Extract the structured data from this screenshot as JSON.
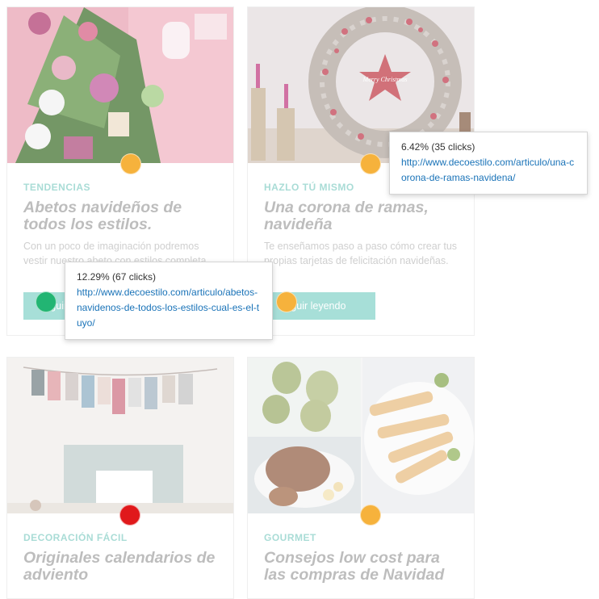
{
  "cards": [
    {
      "category": "TENDENCIAS",
      "title": "Abetos navideños de todos los estilos.",
      "excerpt": "Con un poco de imaginación podremos vestir nuestro abeto con estilos completa",
      "button": "Seguir leyendo"
    },
    {
      "category": "HAZLO TÚ MISMO",
      "title": "Una corona de ramas, navideña",
      "excerpt": "Te enseñamos paso a paso cómo crear tus propias tarjetas de felicitación navideñas.",
      "button": "Seguir leyendo",
      "sign_text": "Merry Christmas"
    },
    {
      "category": "DECORACIÓN FÁCIL",
      "title": "Originales calendarios de adviento"
    },
    {
      "category": "GOURMET",
      "title": "Consejos low cost para las compras de Navidad"
    }
  ],
  "heatmap_dots": [
    {
      "id": "card1-image",
      "color": "#f6b23c"
    },
    {
      "id": "card2-image",
      "color": "#f6b23c"
    },
    {
      "id": "card1-button",
      "color": "#22b573"
    },
    {
      "id": "card2-button",
      "color": "#f6b23c"
    },
    {
      "id": "card3-image",
      "color": "#e0191b"
    },
    {
      "id": "card4-image",
      "color": "#f6b23c"
    }
  ],
  "tooltips": {
    "card1": {
      "stat": "12.29% (67 clicks)",
      "url": "http://www.decoestilo.com/articulo/abetos-navidenos-de-todos-los-estilos-cual-es-el-tuyo/"
    },
    "card2": {
      "stat": "6.42% (35 clicks)",
      "url": "http://www.decoestilo.com/articulo/una-corona-de-ramas-navidena/"
    }
  }
}
